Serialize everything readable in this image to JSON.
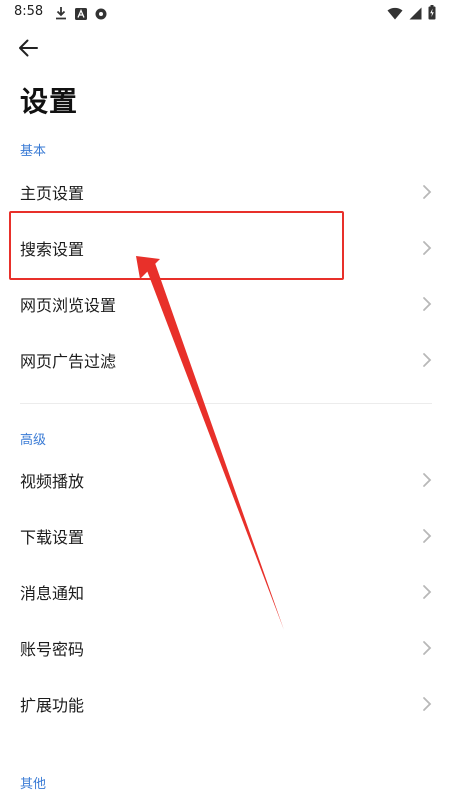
{
  "status_bar": {
    "time": "8:58",
    "left_icons": [
      "download-icon",
      "font-icon",
      "record-icon"
    ],
    "right_icons": [
      "wifi-icon",
      "signal-icon",
      "battery-charging-icon"
    ]
  },
  "header": {
    "back_icon": "arrow-left-icon",
    "title": "设置"
  },
  "sections": {
    "basic": {
      "header": "基本",
      "items": [
        {
          "label": "主页设置"
        },
        {
          "label": "搜索设置",
          "highlighted": true
        },
        {
          "label": "网页浏览设置"
        },
        {
          "label": "网页广告过滤"
        }
      ]
    },
    "advanced": {
      "header": "高级",
      "items": [
        {
          "label": "视频播放"
        },
        {
          "label": "下载设置"
        },
        {
          "label": "消息通知"
        },
        {
          "label": "账号密码"
        },
        {
          "label": "扩展功能"
        }
      ]
    },
    "other": {
      "header": "其他"
    }
  },
  "colors": {
    "section_header": "#3a7bd5",
    "annotation": "#e8302a",
    "chevron": "#b8b8b8"
  }
}
